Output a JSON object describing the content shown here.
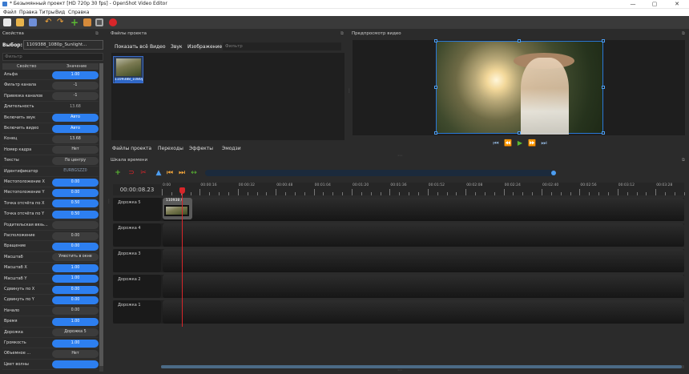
{
  "window": {
    "title": "* Безымянный проект [HD 720p 30 fps] - OpenShot Video Editor",
    "min": "—",
    "max": "▢",
    "close": "✕"
  },
  "menu": [
    "Файл",
    "Правка",
    "Титры",
    "Вид",
    "Справка"
  ],
  "toolbar": [
    "new-project",
    "open-project",
    "save-project",
    "undo",
    "redo",
    "import-files",
    "profile",
    "fullscreen",
    "export-video"
  ],
  "properties": {
    "header": "Свойства",
    "select_label": "Выбор:",
    "select_value": "1109388_1080p_Sunlight...",
    "filter_placeholder": "Фильтр",
    "col_property": "Свойство",
    "col_value": "Значение",
    "rows": [
      {
        "k": "Альфа",
        "v": "1.00",
        "s": "blue"
      },
      {
        "k": "Фильтр канала",
        "v": "-1",
        "s": "grey"
      },
      {
        "k": "Привязка каналов",
        "v": "-1",
        "s": "grey"
      },
      {
        "k": "Длительность",
        "v": "13.68",
        "s": "plain"
      },
      {
        "k": "Включить звук",
        "v": "Авто",
        "s": "blue"
      },
      {
        "k": "Включить видео",
        "v": "Авто",
        "s": "blue"
      },
      {
        "k": "Конец",
        "v": "13.68",
        "s": "grey"
      },
      {
        "k": "Номер кадра",
        "v": "Нет",
        "s": "grey"
      },
      {
        "k": "Тексты",
        "v": "По центру",
        "s": "grey"
      },
      {
        "k": "Идентификатор",
        "v": "EURBGSZZ0",
        "s": "ghost"
      },
      {
        "k": "Местоположение X",
        "v": "0.00",
        "s": "blue"
      },
      {
        "k": "Местоположение Y",
        "v": "0.00",
        "s": "blue"
      },
      {
        "k": "Точка отсчёта по X",
        "v": "0.50",
        "s": "blue"
      },
      {
        "k": "Точка отсчёта по Y",
        "v": "0.50",
        "s": "blue"
      },
      {
        "k": "Родительская вязь...",
        "v": "",
        "s": "grey"
      },
      {
        "k": "Расположение",
        "v": "0.00",
        "s": "grey"
      },
      {
        "k": "Вращение",
        "v": "0.00",
        "s": "blue"
      },
      {
        "k": "Масштаб",
        "v": "Уместить в окне",
        "s": "grey"
      },
      {
        "k": "Масштаб X",
        "v": "1.00",
        "s": "blue"
      },
      {
        "k": "Масштаб Y",
        "v": "1.00",
        "s": "blue"
      },
      {
        "k": "Сдвинуть по X",
        "v": "0.00",
        "s": "blue"
      },
      {
        "k": "Сдвинуть по Y",
        "v": "0.00",
        "s": "blue"
      },
      {
        "k": "Начало",
        "v": "0.00",
        "s": "grey"
      },
      {
        "k": "Время",
        "v": "1.00",
        "s": "blue"
      },
      {
        "k": "Дорожка",
        "v": "Дорожка 5",
        "s": "grey"
      },
      {
        "k": "Громкость",
        "v": "1.00",
        "s": "blue"
      },
      {
        "k": "Объемное ...",
        "v": "Нет",
        "s": "grey"
      },
      {
        "k": "Цвет волны",
        "v": "",
        "s": "blue"
      }
    ]
  },
  "files": {
    "header": "Файлы проекта",
    "tabs": [
      "Показать всё",
      "Видео",
      "Звук",
      "Изображение"
    ],
    "filter_placeholder": "Фильтр",
    "item_label": "1109388_1080p_S..."
  },
  "preview": {
    "header": "Предпросмотр видео",
    "controls": [
      "⏮",
      "⏪",
      "▶",
      "⏩",
      "⏭"
    ]
  },
  "bottom_tabs": [
    "Файлы проекта",
    "Переходы",
    "Эффекты",
    "Эмодзи"
  ],
  "timeline": {
    "header": "Шкала времени",
    "timecode": "00:00:08.23",
    "ruler": [
      "0:00",
      "00:00:16",
      "00:00:32",
      "00:00:48",
      "00:01:04",
      "00:01:20",
      "00:01:36",
      "00:01:52",
      "00:02:08",
      "00:02:24",
      "00:02:40",
      "00:02:56",
      "00:03:12",
      "00:03:28"
    ],
    "tracks": [
      "Дорожка 5",
      "Дорожка 4",
      "Дорожка 3",
      "Дорожка 2",
      "Дорожка 1"
    ],
    "clip_title": "110938 /"
  },
  "colors": {
    "accent": "#2d7ff0",
    "playhead": "#d8262a"
  }
}
